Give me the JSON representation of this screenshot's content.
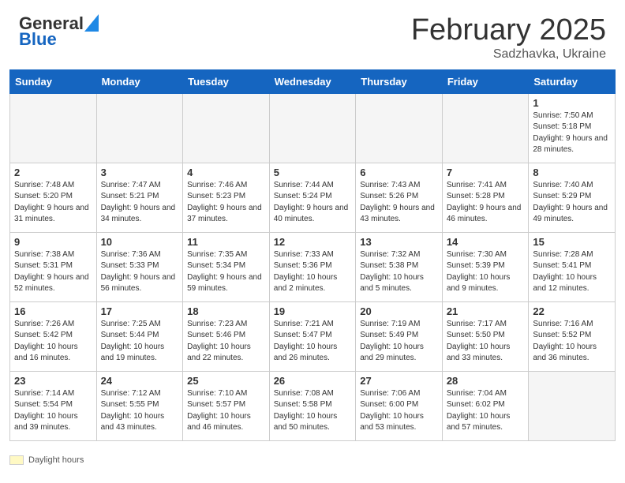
{
  "header": {
    "logo_general": "General",
    "logo_blue": "Blue",
    "title": "February 2025",
    "subtitle": "Sadzhavka, Ukraine"
  },
  "calendar": {
    "days_of_week": [
      "Sunday",
      "Monday",
      "Tuesday",
      "Wednesday",
      "Thursday",
      "Friday",
      "Saturday"
    ],
    "weeks": [
      [
        {
          "num": "",
          "detail": ""
        },
        {
          "num": "",
          "detail": ""
        },
        {
          "num": "",
          "detail": ""
        },
        {
          "num": "",
          "detail": ""
        },
        {
          "num": "",
          "detail": ""
        },
        {
          "num": "",
          "detail": ""
        },
        {
          "num": "1",
          "detail": "Sunrise: 7:50 AM\nSunset: 5:18 PM\nDaylight: 9 hours and 28 minutes."
        }
      ],
      [
        {
          "num": "2",
          "detail": "Sunrise: 7:48 AM\nSunset: 5:20 PM\nDaylight: 9 hours and 31 minutes."
        },
        {
          "num": "3",
          "detail": "Sunrise: 7:47 AM\nSunset: 5:21 PM\nDaylight: 9 hours and 34 minutes."
        },
        {
          "num": "4",
          "detail": "Sunrise: 7:46 AM\nSunset: 5:23 PM\nDaylight: 9 hours and 37 minutes."
        },
        {
          "num": "5",
          "detail": "Sunrise: 7:44 AM\nSunset: 5:24 PM\nDaylight: 9 hours and 40 minutes."
        },
        {
          "num": "6",
          "detail": "Sunrise: 7:43 AM\nSunset: 5:26 PM\nDaylight: 9 hours and 43 minutes."
        },
        {
          "num": "7",
          "detail": "Sunrise: 7:41 AM\nSunset: 5:28 PM\nDaylight: 9 hours and 46 minutes."
        },
        {
          "num": "8",
          "detail": "Sunrise: 7:40 AM\nSunset: 5:29 PM\nDaylight: 9 hours and 49 minutes."
        }
      ],
      [
        {
          "num": "9",
          "detail": "Sunrise: 7:38 AM\nSunset: 5:31 PM\nDaylight: 9 hours and 52 minutes."
        },
        {
          "num": "10",
          "detail": "Sunrise: 7:36 AM\nSunset: 5:33 PM\nDaylight: 9 hours and 56 minutes."
        },
        {
          "num": "11",
          "detail": "Sunrise: 7:35 AM\nSunset: 5:34 PM\nDaylight: 9 hours and 59 minutes."
        },
        {
          "num": "12",
          "detail": "Sunrise: 7:33 AM\nSunset: 5:36 PM\nDaylight: 10 hours and 2 minutes."
        },
        {
          "num": "13",
          "detail": "Sunrise: 7:32 AM\nSunset: 5:38 PM\nDaylight: 10 hours and 5 minutes."
        },
        {
          "num": "14",
          "detail": "Sunrise: 7:30 AM\nSunset: 5:39 PM\nDaylight: 10 hours and 9 minutes."
        },
        {
          "num": "15",
          "detail": "Sunrise: 7:28 AM\nSunset: 5:41 PM\nDaylight: 10 hours and 12 minutes."
        }
      ],
      [
        {
          "num": "16",
          "detail": "Sunrise: 7:26 AM\nSunset: 5:42 PM\nDaylight: 10 hours and 16 minutes."
        },
        {
          "num": "17",
          "detail": "Sunrise: 7:25 AM\nSunset: 5:44 PM\nDaylight: 10 hours and 19 minutes."
        },
        {
          "num": "18",
          "detail": "Sunrise: 7:23 AM\nSunset: 5:46 PM\nDaylight: 10 hours and 22 minutes."
        },
        {
          "num": "19",
          "detail": "Sunrise: 7:21 AM\nSunset: 5:47 PM\nDaylight: 10 hours and 26 minutes."
        },
        {
          "num": "20",
          "detail": "Sunrise: 7:19 AM\nSunset: 5:49 PM\nDaylight: 10 hours and 29 minutes."
        },
        {
          "num": "21",
          "detail": "Sunrise: 7:17 AM\nSunset: 5:50 PM\nDaylight: 10 hours and 33 minutes."
        },
        {
          "num": "22",
          "detail": "Sunrise: 7:16 AM\nSunset: 5:52 PM\nDaylight: 10 hours and 36 minutes."
        }
      ],
      [
        {
          "num": "23",
          "detail": "Sunrise: 7:14 AM\nSunset: 5:54 PM\nDaylight: 10 hours and 39 minutes."
        },
        {
          "num": "24",
          "detail": "Sunrise: 7:12 AM\nSunset: 5:55 PM\nDaylight: 10 hours and 43 minutes."
        },
        {
          "num": "25",
          "detail": "Sunrise: 7:10 AM\nSunset: 5:57 PM\nDaylight: 10 hours and 46 minutes."
        },
        {
          "num": "26",
          "detail": "Sunrise: 7:08 AM\nSunset: 5:58 PM\nDaylight: 10 hours and 50 minutes."
        },
        {
          "num": "27",
          "detail": "Sunrise: 7:06 AM\nSunset: 6:00 PM\nDaylight: 10 hours and 53 minutes."
        },
        {
          "num": "28",
          "detail": "Sunrise: 7:04 AM\nSunset: 6:02 PM\nDaylight: 10 hours and 57 minutes."
        },
        {
          "num": "",
          "detail": ""
        }
      ]
    ]
  },
  "legend": {
    "label": "Daylight hours"
  }
}
